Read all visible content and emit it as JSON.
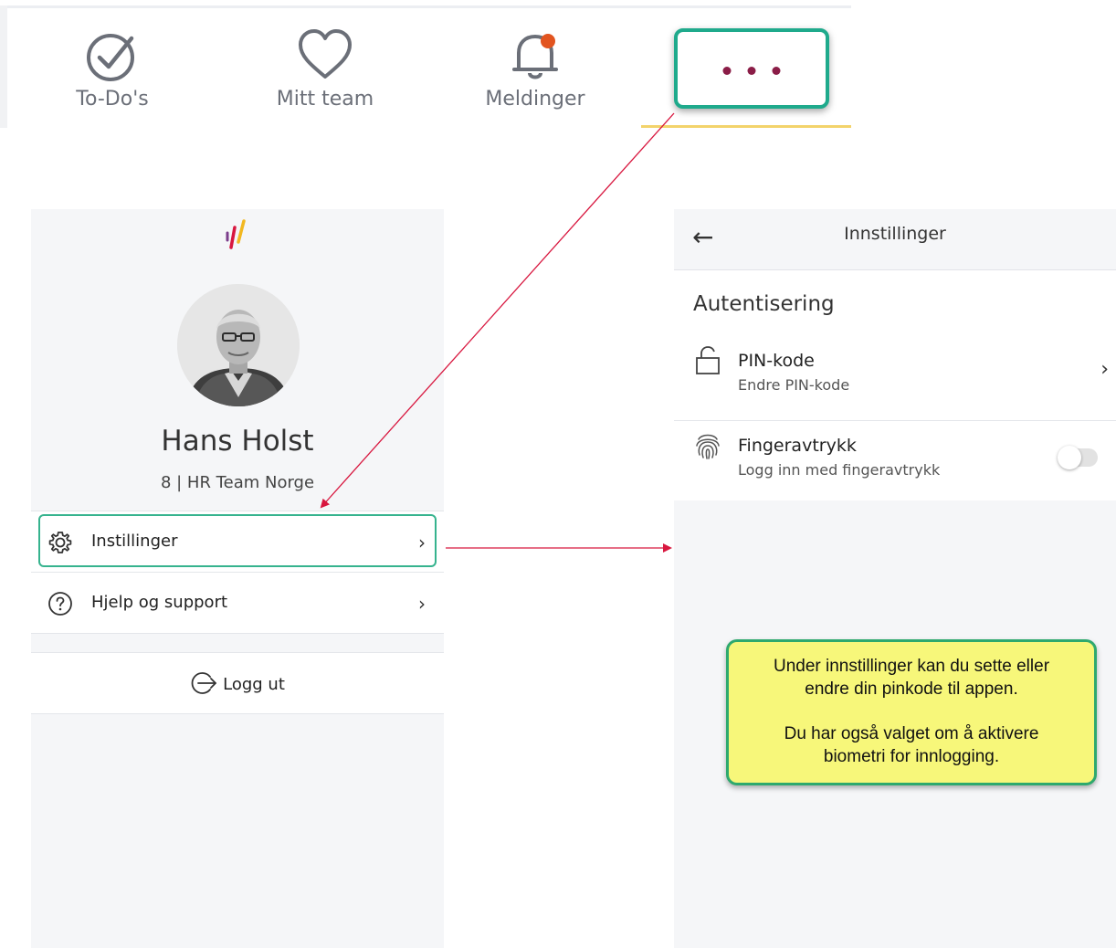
{
  "top_nav": {
    "items": [
      {
        "label": "To-Do's",
        "icon": "check-circle-icon"
      },
      {
        "label": "Mitt team",
        "icon": "heart-icon"
      },
      {
        "label": "Meldinger",
        "icon": "bell-icon"
      }
    ],
    "more_icon": "more-dots-icon"
  },
  "profile": {
    "name": "Hans Holst",
    "team": "8 | HR Team Norge"
  },
  "menu": {
    "items": [
      {
        "label": "Instillinger",
        "icon": "gear-icon"
      },
      {
        "label": "Hjelp og support",
        "icon": "help-circle-icon"
      }
    ],
    "logout_label": "Logg ut"
  },
  "settings": {
    "title": "Innstillinger",
    "section_title": "Autentisering",
    "pin": {
      "title": "PIN-kode",
      "subtitle": "Endre PIN-kode"
    },
    "fingerprint": {
      "title": "Fingeravtrykk",
      "subtitle": "Logg inn med fingeravtrykk",
      "enabled": false
    }
  },
  "callout": {
    "line1": "Under innstillinger kan du sette eller",
    "line2": "endre din pinkode til appen.",
    "line3": "Du har også valget om å aktivere",
    "line4": "biometri for innlogging."
  },
  "colors": {
    "highlight_border": "#1faa8c",
    "arrow": "#d8173f",
    "callout_bg": "#f7f77a",
    "dots": "#8b1d47",
    "notification_dot": "#e2541f"
  }
}
